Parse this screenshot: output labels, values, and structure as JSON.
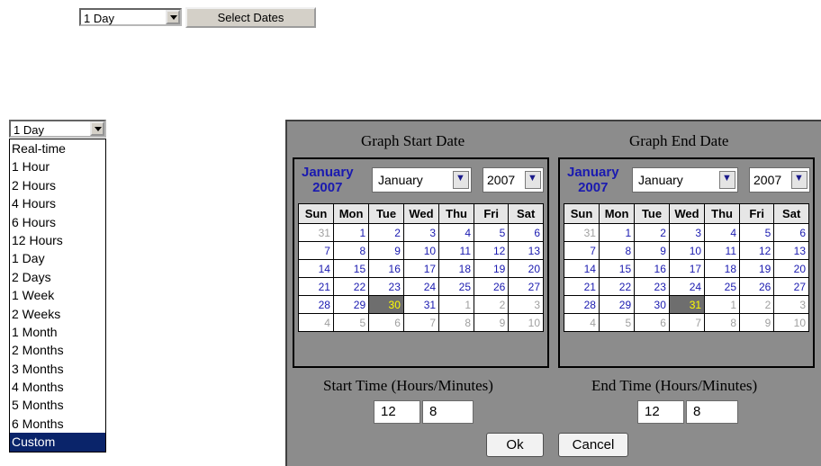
{
  "top_bar": {
    "range_value": "1 Day",
    "select_dates_label": "Select Dates"
  },
  "dropdown": {
    "value": "1 Day",
    "options": [
      "Real-time",
      "1 Hour",
      "2 Hours",
      "4 Hours",
      "6 Hours",
      "12 Hours",
      "1 Day",
      "2 Days",
      "1 Week",
      "2 Weeks",
      "1 Month",
      "2 Months",
      "3 Months",
      "4 Months",
      "5 Months",
      "6 Months",
      "Custom"
    ],
    "selected_option": "Custom"
  },
  "start_calendar": {
    "title": "Graph Start Date",
    "month_label": "January",
    "year_label": "2007",
    "month_select": "January",
    "year_select": "2007",
    "weekdays": [
      "Sun",
      "Mon",
      "Tue",
      "Wed",
      "Thu",
      "Fri",
      "Sat"
    ],
    "weeks": [
      [
        "31",
        "1",
        "2",
        "3",
        "4",
        "5",
        "6"
      ],
      [
        "7",
        "8",
        "9",
        "10",
        "11",
        "12",
        "13"
      ],
      [
        "14",
        "15",
        "16",
        "17",
        "18",
        "19",
        "20"
      ],
      [
        "21",
        "22",
        "23",
        "24",
        "25",
        "26",
        "27"
      ],
      [
        "28",
        "29",
        "30",
        "31",
        "1",
        "2",
        "3"
      ],
      [
        "4",
        "5",
        "6",
        "7",
        "8",
        "9",
        "10"
      ]
    ],
    "selected_day": "30"
  },
  "end_calendar": {
    "title": "Graph End Date",
    "month_label": "January",
    "year_label": "2007",
    "month_select": "January",
    "year_select": "2007",
    "weekdays": [
      "Sun",
      "Mon",
      "Tue",
      "Wed",
      "Thu",
      "Fri",
      "Sat"
    ],
    "weeks": [
      [
        "31",
        "1",
        "2",
        "3",
        "4",
        "5",
        "6"
      ],
      [
        "7",
        "8",
        "9",
        "10",
        "11",
        "12",
        "13"
      ],
      [
        "14",
        "15",
        "16",
        "17",
        "18",
        "19",
        "20"
      ],
      [
        "21",
        "22",
        "23",
        "24",
        "25",
        "26",
        "27"
      ],
      [
        "28",
        "29",
        "30",
        "31",
        "1",
        "2",
        "3"
      ],
      [
        "4",
        "5",
        "6",
        "7",
        "8",
        "9",
        "10"
      ]
    ],
    "selected_day": "31"
  },
  "start_time": {
    "label": "Start Time (Hours/Minutes)",
    "hours": "12",
    "minutes": "8"
  },
  "end_time": {
    "label": "End Time (Hours/Minutes)",
    "hours": "12",
    "minutes": "8"
  },
  "buttons": {
    "ok": "Ok",
    "cancel": "Cancel"
  },
  "colors": {
    "panel_bg": "#8c8c8c",
    "link_blue": "#1a1ab0",
    "today_bg": "#6e6e6e",
    "today_fg": "#ffff00",
    "selected_option_bg": "#0a246a"
  }
}
